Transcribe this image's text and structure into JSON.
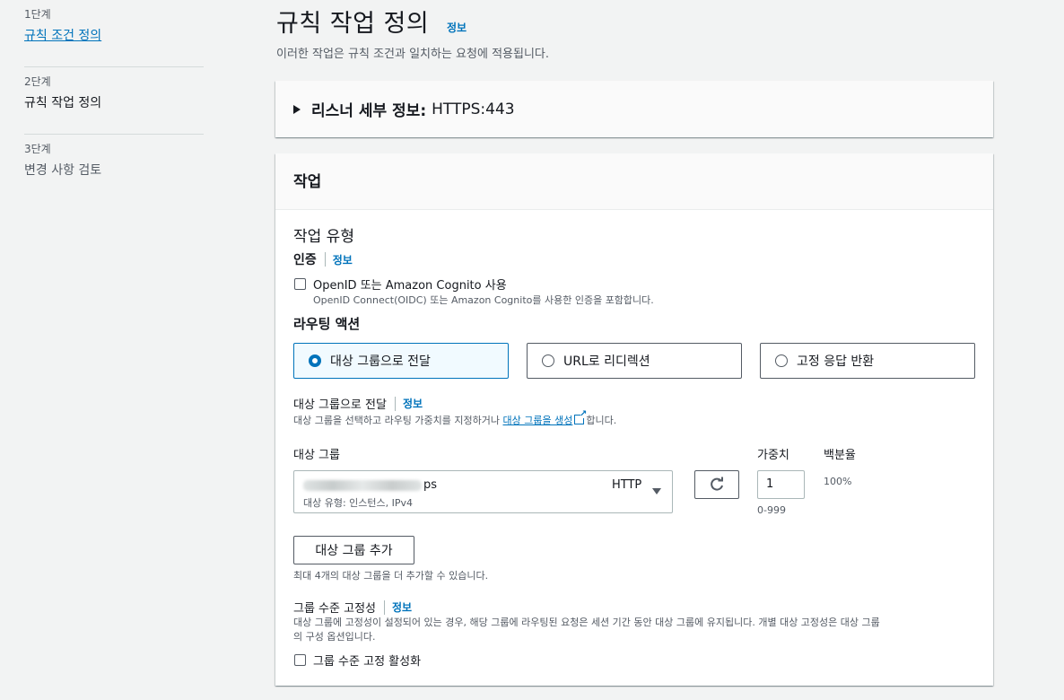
{
  "steps": [
    {
      "num": "1단계",
      "title": "규칙 조건 정의"
    },
    {
      "num": "2단계",
      "title": "규칙 작업 정의"
    },
    {
      "num": "3단계",
      "title": "변경 사항 검토"
    }
  ],
  "header": {
    "title": "규칙 작업 정의",
    "info": "정보",
    "description": "이러한 작업은 규칙 조건과 일치하는 요청에 적용됩니다."
  },
  "listener": {
    "label": "리스너 세부 정보:",
    "value": "HTTPS:443"
  },
  "action": {
    "panel_title": "작업",
    "type_label": "작업 유형",
    "auth": {
      "label": "인증",
      "info": "정보",
      "checkbox_label": "OpenID 또는 Amazon Cognito 사용",
      "checkbox_desc": "OpenID Connect(OIDC) 또는 Amazon Cognito를 사용한 인증을 포함합니다."
    },
    "routing": {
      "label": "라우팅 액션",
      "options": [
        "대상 그룹으로 전달",
        "URL로 리디렉션",
        "고정 응답 반환"
      ],
      "selected": "대상 그룹으로 전달"
    },
    "forward": {
      "label": "대상 그룹으로 전달",
      "info": "정보",
      "desc_before": "대상 그룹을 선택하고 라우팅 가중치를 지정하거나 ",
      "desc_link": "대상 그룹을 생성",
      "desc_after": "합니다."
    },
    "target_group": {
      "label": "대상 그룹",
      "value_visible": "ps",
      "protocol": "HTTP",
      "subtext": "대상 유형: 인스턴스, IPv4",
      "weight_label": "가중치",
      "weight_value": "1",
      "weight_range": "0-999",
      "percent_label": "백분율",
      "percent_value": "100%"
    },
    "add_group": {
      "button": "대상 그룹 추가",
      "desc": "최대 4개의 대상 그룹을 더 추가할 수 있습니다."
    },
    "stickiness": {
      "label": "그룹 수준 고정성",
      "info": "정보",
      "desc_line1": "대상 그룹에 고정성이 설정되어 있는 경우, 해당 그룹에 라우팅된 요청은 세션 기간 동안 대상 그룹에 유지됩니다. 개별 대상 고정성은 대상 그룹",
      "desc_line2": "의 구성 옵션입니다.",
      "checkbox_label": "그룹 수준 고정 활성화"
    }
  }
}
